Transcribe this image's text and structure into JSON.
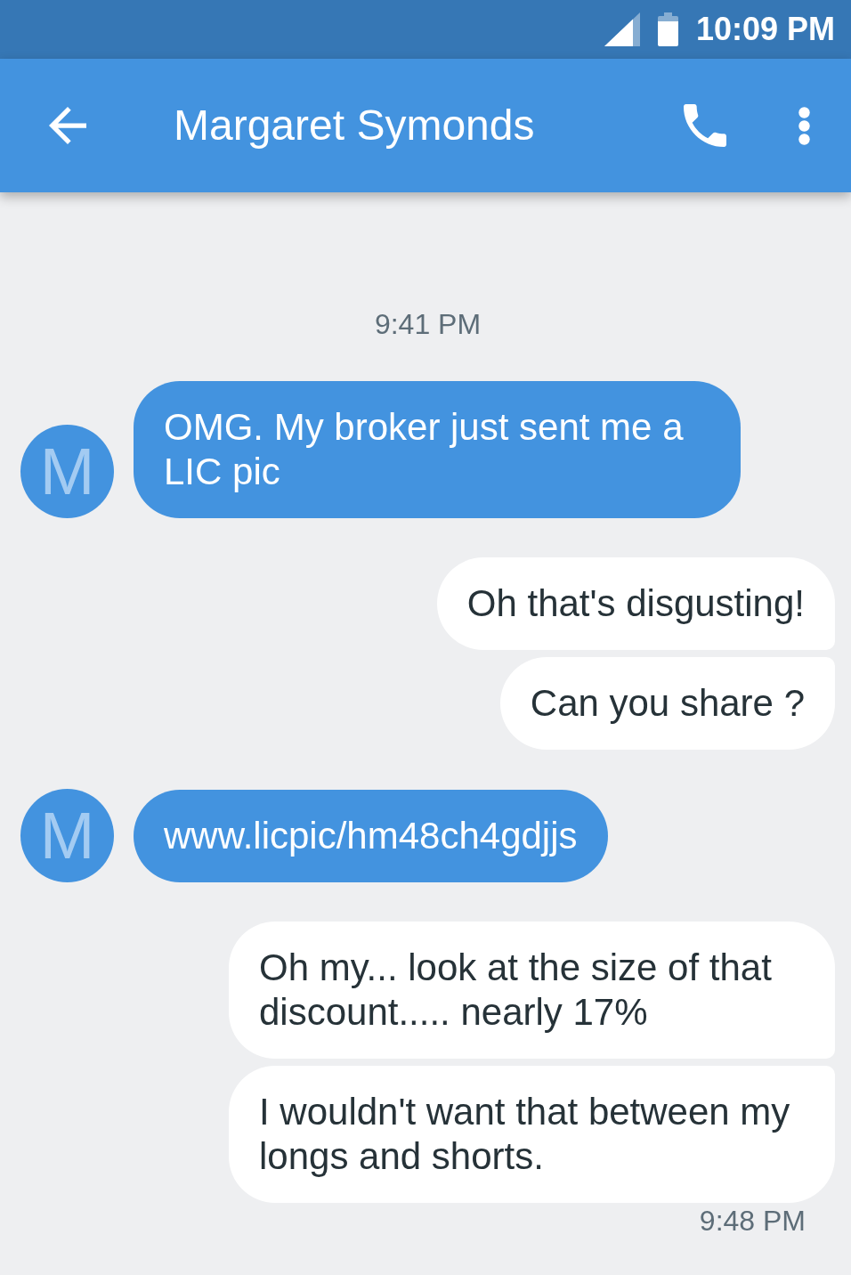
{
  "status_bar": {
    "time": "10:09 PM"
  },
  "app_bar": {
    "title": "Margaret Symonds"
  },
  "messages": [
    {
      "kind": "timestamp",
      "text": "9:41 PM"
    },
    {
      "kind": "incoming",
      "avatar": "M",
      "text": "OMG. My broker just sent me a LIC pic"
    },
    {
      "kind": "outgoing",
      "text": "Oh that's disgusting!"
    },
    {
      "kind": "outgoing",
      "text": "Can you share ?"
    },
    {
      "kind": "incoming",
      "avatar": "M",
      "text": "www.licpic/hm48ch4gdjjs"
    },
    {
      "kind": "outgoing",
      "text": "Oh my... look at the size of that discount..... nearly 17%"
    },
    {
      "kind": "outgoing",
      "text": "I wouldn't want that between my longs and shorts."
    },
    {
      "kind": "delivery_time",
      "text": "9:48 PM"
    }
  ]
}
